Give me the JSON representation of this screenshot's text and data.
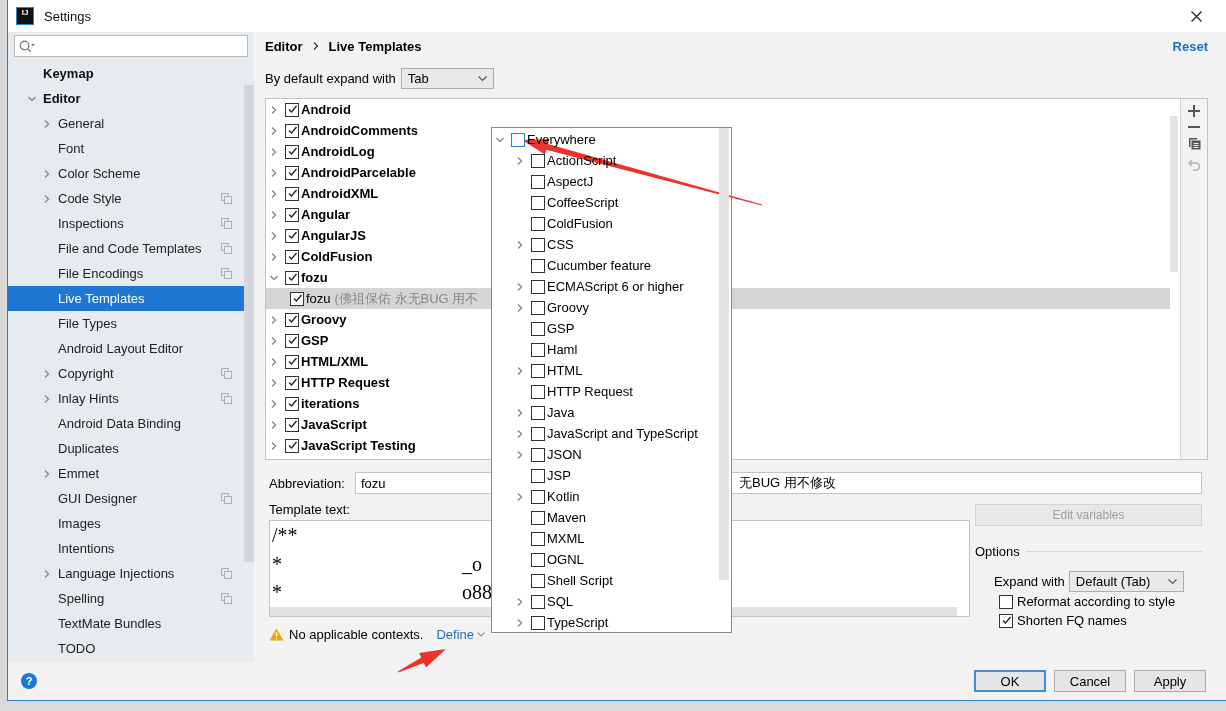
{
  "window": {
    "icon_text": "IJ",
    "title": "Settings"
  },
  "sidebar": {
    "items": [
      {
        "label": "Keymap",
        "selected": false,
        "project_scope": false
      },
      {
        "label": "Editor",
        "selected": false,
        "project_scope": false,
        "expanded": true,
        "children": [
          {
            "label": "General",
            "selected": false,
            "project_scope": false,
            "expanded": false
          },
          {
            "label": "Font",
            "selected": false,
            "project_scope": false
          },
          {
            "label": "Color Scheme",
            "selected": false,
            "project_scope": false,
            "expanded": false
          },
          {
            "label": "Code Style",
            "selected": false,
            "project_scope": true,
            "expanded": false
          },
          {
            "label": "Inspections",
            "selected": false,
            "project_scope": true
          },
          {
            "label": "File and Code Templates",
            "selected": false,
            "project_scope": true
          },
          {
            "label": "File Encodings",
            "selected": false,
            "project_scope": true
          },
          {
            "label": "Live Templates",
            "selected": true,
            "project_scope": false
          },
          {
            "label": "File Types",
            "selected": false,
            "project_scope": false
          },
          {
            "label": "Android Layout Editor",
            "selected": false,
            "project_scope": false
          },
          {
            "label": "Copyright",
            "selected": false,
            "project_scope": true,
            "expanded": false
          },
          {
            "label": "Inlay Hints",
            "selected": false,
            "project_scope": true,
            "expanded": false
          },
          {
            "label": "Android Data Binding",
            "selected": false,
            "project_scope": false
          },
          {
            "label": "Duplicates",
            "selected": false,
            "project_scope": false
          },
          {
            "label": "Emmet",
            "selected": false,
            "project_scope": false,
            "expanded": false
          },
          {
            "label": "GUI Designer",
            "selected": false,
            "project_scope": true
          },
          {
            "label": "Images",
            "selected": false,
            "project_scope": false
          },
          {
            "label": "Intentions",
            "selected": false,
            "project_scope": false
          },
          {
            "label": "Language Injections",
            "selected": false,
            "project_scope": true,
            "expanded": false
          },
          {
            "label": "Spelling",
            "selected": false,
            "project_scope": true
          },
          {
            "label": "TextMate Bundles",
            "selected": false,
            "project_scope": false
          },
          {
            "label": "TODO",
            "selected": false,
            "project_scope": false
          }
        ]
      }
    ]
  },
  "breadcrumb": [
    "Editor",
    "Live Templates"
  ],
  "reset_link": "Reset",
  "expand_default": {
    "label": "By default expand with",
    "value": "Tab"
  },
  "template_groups": [
    {
      "name": "Android",
      "checked": true,
      "expanded": false,
      "selected": false
    },
    {
      "name": "AndroidComments",
      "checked": true,
      "expanded": false,
      "selected": false
    },
    {
      "name": "AndroidLog",
      "checked": true,
      "expanded": false,
      "selected": false
    },
    {
      "name": "AndroidParcelable",
      "checked": true,
      "expanded": false,
      "selected": false
    },
    {
      "name": "AndroidXML",
      "checked": true,
      "expanded": false,
      "selected": false
    },
    {
      "name": "Angular",
      "checked": true,
      "expanded": false,
      "selected": false
    },
    {
      "name": "AngularJS",
      "checked": true,
      "expanded": false,
      "selected": false
    },
    {
      "name": "ColdFusion",
      "checked": true,
      "expanded": false,
      "selected": false
    },
    {
      "name": "fozu",
      "checked": true,
      "expanded": true,
      "selected": false,
      "children": [
        {
          "name": "fozu",
          "description": "(佛祖保佑  永无BUG  用不",
          "checked": true,
          "selected": true
        }
      ]
    },
    {
      "name": "Groovy",
      "checked": true,
      "expanded": false,
      "selected": false
    },
    {
      "name": "GSP",
      "checked": true,
      "expanded": false,
      "selected": false
    },
    {
      "name": "HTML/XML",
      "checked": true,
      "expanded": false,
      "selected": false
    },
    {
      "name": "HTTP Request",
      "checked": true,
      "expanded": false,
      "selected": false
    },
    {
      "name": "iterations",
      "checked": true,
      "expanded": false,
      "selected": false
    },
    {
      "name": "JavaScript",
      "checked": true,
      "expanded": false,
      "selected": false
    },
    {
      "name": "JavaScript Testing",
      "checked": true,
      "expanded": false,
      "selected": false
    }
  ],
  "abbreviation": {
    "label": "Abbreviation:",
    "value": "fozu"
  },
  "description": {
    "value": "无BUG  用不修改"
  },
  "template_text": {
    "label": "Template text:",
    "lines": [
      {
        "star": "/**"
      },
      {
        "star": "*",
        "tail": "_o"
      },
      {
        "star": "*",
        "tail": "o88"
      }
    ]
  },
  "edit_variables": {
    "label": "Edit variables",
    "disabled": true
  },
  "options": {
    "title": "Options",
    "expand_with": {
      "label": "Expand with",
      "value": "Default (Tab)"
    },
    "checkboxes": [
      {
        "label": "Reformat according to style",
        "checked": false
      },
      {
        "label": "Shorten FQ names",
        "checked": true
      }
    ]
  },
  "warning": {
    "text": "No applicable contexts.",
    "link": "Define"
  },
  "contexts": [
    {
      "label": "Everywhere",
      "checked": false,
      "expanded": true,
      "children": [
        {
          "label": "ActionScript",
          "checked": false,
          "expanded": false
        },
        {
          "label": "AspectJ",
          "checked": false
        },
        {
          "label": "CoffeeScript",
          "checked": false
        },
        {
          "label": "ColdFusion",
          "checked": false
        },
        {
          "label": "CSS",
          "checked": false,
          "expanded": false
        },
        {
          "label": "Cucumber feature",
          "checked": false
        },
        {
          "label": "ECMAScript 6 or higher",
          "checked": false,
          "expanded": false
        },
        {
          "label": "Groovy",
          "checked": false,
          "expanded": false
        },
        {
          "label": "GSP",
          "checked": false
        },
        {
          "label": "Haml",
          "checked": false
        },
        {
          "label": "HTML",
          "checked": false,
          "expanded": false
        },
        {
          "label": "HTTP Request",
          "checked": false
        },
        {
          "label": "Java",
          "checked": false,
          "expanded": false
        },
        {
          "label": "JavaScript and TypeScript",
          "checked": false,
          "expanded": false
        },
        {
          "label": "JSON",
          "checked": false,
          "expanded": false
        },
        {
          "label": "JSP",
          "checked": false
        },
        {
          "label": "Kotlin",
          "checked": false,
          "expanded": false
        },
        {
          "label": "Maven",
          "checked": false
        },
        {
          "label": "MXML",
          "checked": false
        },
        {
          "label": "OGNL",
          "checked": false
        },
        {
          "label": "Shell Script",
          "checked": false
        },
        {
          "label": "SQL",
          "checked": false,
          "expanded": false
        },
        {
          "label": "TypeScript",
          "checked": false,
          "expanded": false
        }
      ]
    }
  ],
  "help": "?",
  "buttons": [
    {
      "label": "OK",
      "focused": true
    },
    {
      "label": "Cancel",
      "focused": false
    },
    {
      "label": "Apply",
      "focused": false
    }
  ]
}
